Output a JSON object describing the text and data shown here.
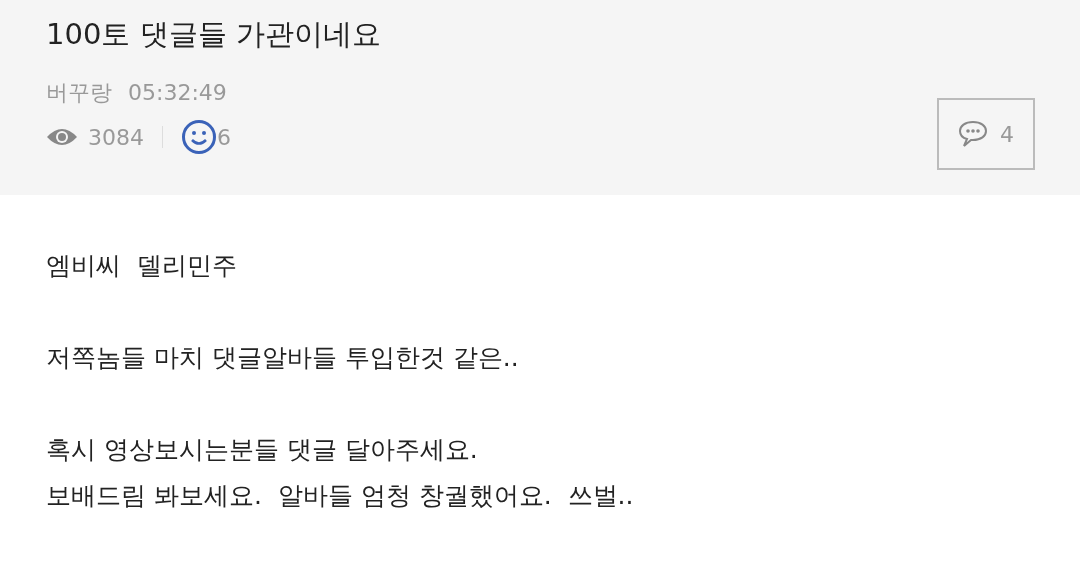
{
  "post": {
    "title": "100토 댓글들 가관이네요",
    "author": "버꾸랑",
    "time": "05:32:49",
    "views": "3084",
    "likes": "6",
    "comments": "4"
  },
  "body": [
    {
      "kind": "line",
      "text": "엠비씨  델리민주"
    },
    {
      "kind": "blank"
    },
    {
      "kind": "line",
      "text": "저쪽놈들 마치 댓글알바들 투입한것 같은.."
    },
    {
      "kind": "blank"
    },
    {
      "kind": "line",
      "text": "혹시 영상보시는분들 댓글 달아주세요."
    },
    {
      "kind": "line",
      "text": "보배드림 봐보세요.  알바들 엄청 창궐했어요.  쓰벌.."
    }
  ]
}
